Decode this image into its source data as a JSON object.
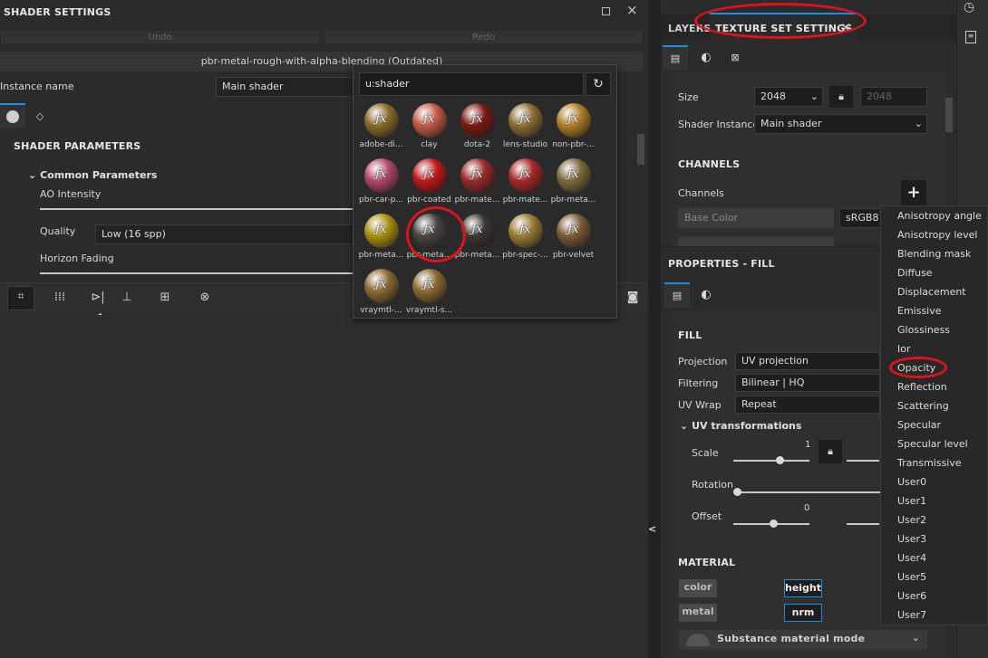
{
  "shader_panel": {
    "title": "SHADER SETTINGS",
    "undo": "Undo",
    "redo": "Redo",
    "shader_name": "pbr-metal-rough-with-alpha-blending (Outdated)",
    "instance_label": "Instance name",
    "instance_value": "Main shader",
    "params_title": "SHADER PARAMETERS",
    "group_title": "Common Parameters",
    "ao_label": "AO Intensity",
    "quality_label": "Quality",
    "quality_value": "Low (16 spp)",
    "horizon_label": "Horizon Fading"
  },
  "shelf_popup": {
    "search_value": "u:shader",
    "items": [
      {
        "label": "adobe-di...",
        "color": "#8a6a2a"
      },
      {
        "label": "clay",
        "color": "#c45a46"
      },
      {
        "label": "dota-2",
        "color": "#7a1a12"
      },
      {
        "label": "lens-studio",
        "color": "#8c6c36"
      },
      {
        "label": "non-pbr-...",
        "color": "#b07e2a"
      },
      {
        "label": "pbr-car-p...",
        "color": "#b04868"
      },
      {
        "label": "pbr-coated",
        "color": "#c01818"
      },
      {
        "label": "pbr-mate...",
        "color": "#9a2a2a"
      },
      {
        "label": "pbr-mate...",
        "color": "#a82828"
      },
      {
        "label": "pbr-meta...",
        "color": "#7a6a3a"
      },
      {
        "label": "pbr-meta...",
        "color": "#a89010"
      },
      {
        "label": "pbr-meta...",
        "color": "#4a4642"
      },
      {
        "label": "pbr-meta...",
        "color": "#3a3634"
      },
      {
        "label": "pbr-spec-...",
        "color": "#9a7a34"
      },
      {
        "label": "pbr-velvet",
        "color": "#7a5a38"
      },
      {
        "label": "vraymtl-...",
        "color": "#8a6a32"
      },
      {
        "label": "vraymtl-s...",
        "color": "#8a6a32"
      }
    ]
  },
  "tabs": {
    "layers": "LAYERS",
    "texture_set": "TEXTURE SET SETTINGS",
    "close": "×"
  },
  "texture_set": {
    "size_label": "Size",
    "size_value": "2048",
    "size_value_2": "2048",
    "shader_instance_label": "Shader Instance",
    "shader_instance_value": "Main shader",
    "channels_title": "CHANNELS",
    "channels_label": "Channels",
    "add": "+",
    "base_color": "Base Color",
    "format": "sRGB8"
  },
  "properties": {
    "title": "PROPERTIES - FILL",
    "fill_title": "FILL",
    "projection_label": "Projection",
    "projection_value": "UV projection",
    "filtering_label": "Filtering",
    "filtering_value": "Bilinear | HQ",
    "uvwrap_label": "UV Wrap",
    "uvwrap_value": "Repeat",
    "uvtrans_title": "UV transformations",
    "scale_label": "Scale",
    "scale_value": "1",
    "rotation_label": "Rotation",
    "offset_label": "Offset",
    "offset_value": "0",
    "material_title": "MATERIAL",
    "color": "color",
    "height": "height",
    "metal": "metal",
    "nrm": "nrm",
    "substance_mode": "Substance material mode",
    "collapse_arrow": "<"
  },
  "channel_dropdown": [
    "Anisotropy angle",
    "Anisotropy level",
    "Blending mask",
    "Diffuse",
    "Displacement",
    "Emissive",
    "Glossiness",
    "Ior",
    "Opacity",
    "Reflection",
    "Scattering",
    "Specular",
    "Specular level",
    "Transmissive",
    "User0",
    "User1",
    "User2",
    "User3",
    "User4",
    "User5",
    "User6",
    "User7"
  ],
  "colors": {
    "accent": "#1e8ee0",
    "annotation": "#e0121c"
  }
}
